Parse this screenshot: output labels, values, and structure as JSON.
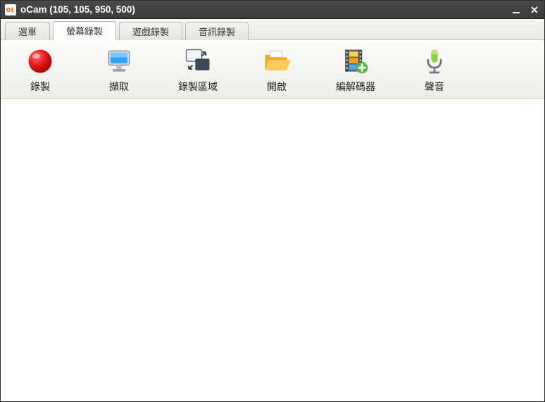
{
  "title": "oCam (105, 105, 950, 500)",
  "tabs": [
    {
      "label": "選單",
      "active": false
    },
    {
      "label": "螢幕錄製",
      "active": true
    },
    {
      "label": "遊戲錄製",
      "active": false
    },
    {
      "label": "音訊錄製",
      "active": false
    }
  ],
  "toolbar": [
    {
      "name": "record-button",
      "label": "錄製",
      "icon": "record-icon"
    },
    {
      "name": "capture-button",
      "label": "擷取",
      "icon": "monitor-icon"
    },
    {
      "name": "area-button",
      "label": "錄製區域",
      "icon": "resize-icon"
    },
    {
      "name": "open-button",
      "label": "開啟",
      "icon": "folder-open-icon"
    },
    {
      "name": "codec-button",
      "label": "編解碼器",
      "icon": "codec-icon"
    },
    {
      "name": "sound-button",
      "label": "聲音",
      "icon": "mic-icon"
    }
  ]
}
